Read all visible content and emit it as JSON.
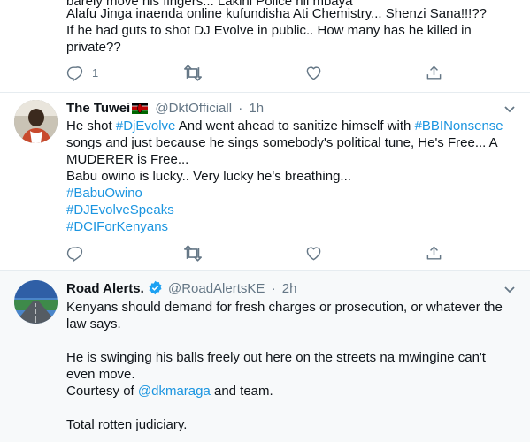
{
  "tweets": [
    {
      "lines": [
        "barely move his fingers... Lakini Police hii mbaya",
        "Alafu Jinga inaenda online kufundisha Ati Chemistry... Shenzi Sana!!!??",
        "If he had guts to shot DJ Evolve in public.. How many has he killed in",
        "private??"
      ],
      "actions": {
        "reply_count": "1"
      }
    },
    {
      "author": {
        "name": "The Tuwei",
        "handle": "@DktOfficiall",
        "time": "1h"
      },
      "text": {
        "l1a": "He shot ",
        "l1_mention": "#DjEvolve",
        "l1b": " And went ahead to sanitize himself with ",
        "l1_tag": "#BBINonsense",
        "l2": " songs and just because he sings somebody's political tune, He's Free... A",
        "l3": "MUDERER is Free...",
        "l4": "Babu owino is lucky.. Very lucky he's breathing...",
        "hashtags": [
          "#BabuOwino",
          "#DJEvolveSpeaks",
          "#DCIForKenyans"
        ]
      }
    },
    {
      "author": {
        "name": "Road Alerts.",
        "handle": "@RoadAlertsKE",
        "time": "2h"
      },
      "text": {
        "l1": "Kenyans should demand for fresh charges or prosecution, or whatever the",
        "l2": "law says.",
        "l3": "He is swinging his balls freely out here on the streets na mwingine can't",
        "l4": "even move.",
        "l5a": "Courtesy of ",
        "l5_mention": "@dkmaraga",
        "l5b": " and team.",
        "l6": "Total rotten judiciary."
      }
    }
  ],
  "separator": "·",
  "icons": [
    "reply-icon",
    "retweet-icon",
    "like-icon",
    "share-icon",
    "chevron-down-icon",
    "kenya-flag-icon",
    "verified-badge-icon"
  ],
  "colors": {
    "link": "#1b95e0",
    "muted": "#657786",
    "divider": "#e6ecf0",
    "highlight_bg": "#f7f9fa",
    "verified": "#1da1f2"
  }
}
